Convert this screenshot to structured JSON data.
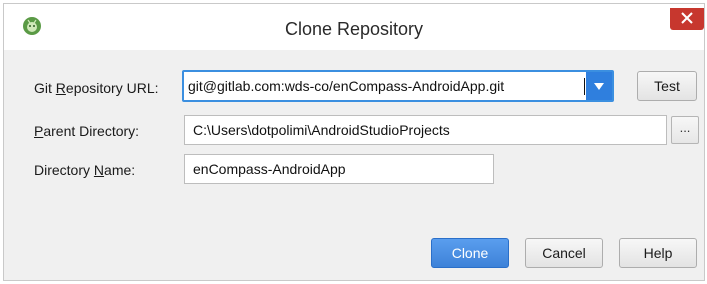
{
  "window": {
    "title": "Clone Repository",
    "close_glyph": "✕",
    "app_icon": "android-studio-icon"
  },
  "form": {
    "repo_url_label": {
      "pre": "Git ",
      "mnemonic": "R",
      "post": "epository URL:"
    },
    "repo_url_value": "git@gitlab.com:wds-co/enCompass-AndroidApp.git",
    "parent_dir_label": {
      "pre": "",
      "mnemonic": "P",
      "post": "arent Directory:"
    },
    "parent_dir_value": "C:\\Users\\dotpolimi\\AndroidStudioProjects",
    "dir_name_label": {
      "pre": "Directory ",
      "mnemonic": "N",
      "post": "ame:"
    },
    "dir_name_value": "enCompass-AndroidApp",
    "browse_label": "..."
  },
  "buttons": {
    "test": "Test",
    "clone": "Clone",
    "cancel": "Cancel",
    "help": "Help"
  },
  "colors": {
    "accent": "#3b8fe0",
    "close": "#c7372e"
  }
}
